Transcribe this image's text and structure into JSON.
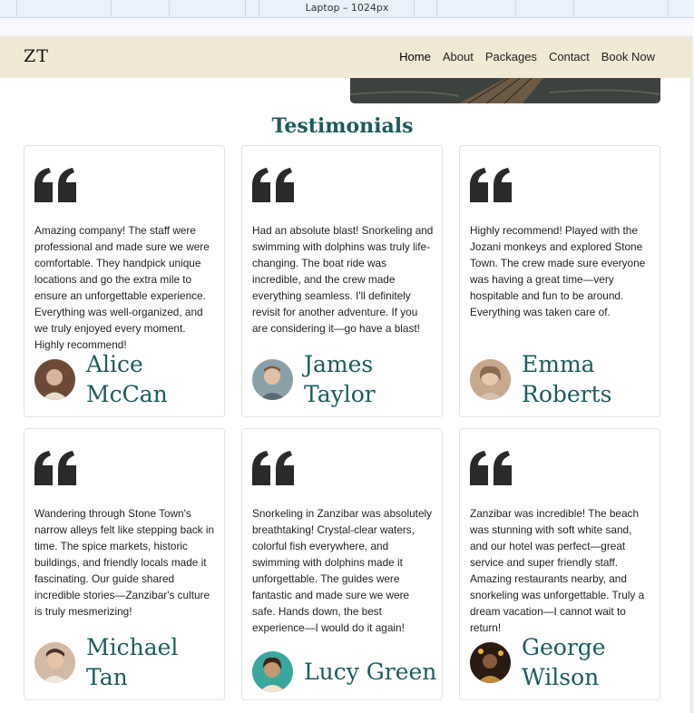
{
  "devtools": {
    "viewport_label": "Laptop – 1024px"
  },
  "nav": {
    "logo": "ZT",
    "links": [
      {
        "label": "Home",
        "active": true
      },
      {
        "label": "About",
        "active": false
      },
      {
        "label": "Packages",
        "active": false
      },
      {
        "label": "Contact",
        "active": false
      },
      {
        "label": "Book Now",
        "active": false
      }
    ]
  },
  "testimonials": {
    "title": "Testimonials",
    "items": [
      {
        "text": "Amazing company! The staff were professional and made sure we were comfortable. They handpick unique locations and go the extra mile to ensure an unforgettable experience. Everything was well-organized, and we truly enjoyed every moment. Highly recommend!",
        "name_line1": "Alice",
        "name_line2": "McCan",
        "avatar_color": "#7a4a34"
      },
      {
        "text": "Had an absolute blast! Snorkeling and swimming with dolphins was truly life-changing. The boat ride was incredible, and the crew made everything seamless. I'll definitely revisit for another adventure. If you are considering it—go have a blast!",
        "name_line1": "James",
        "name_line2": "Taylor",
        "avatar_color": "#8aa0a8"
      },
      {
        "text": "Highly recommend! Played with the Jozani monkeys and explored Stone Town. The crew made sure everyone was having a great time—very hospitable and fun to be around. Everything was taken care of.",
        "name_line1": "Emma",
        "name_line2": "Roberts",
        "avatar_color": "#b08a70"
      },
      {
        "text": "Wandering through Stone Town's narrow alleys felt like stepping back in time. The spice markets, historic buildings, and friendly locals made it fascinating. Our guide shared incredible stories—Zanzibar's culture is truly mesmerizing!",
        "name_line1": "Michael",
        "name_line2": "Tan",
        "avatar_color": "#b89078"
      },
      {
        "text": "Snorkeling in Zanzibar was absolutely breathtaking! Crystal-clear waters, colorful fish everywhere, and swimming with dolphins made it unforgettable. The guides were fantastic and made sure we were safe. Hands down, the best experience—I would do it again!",
        "name_line1": "Lucy Green",
        "name_line2": "",
        "avatar_color": "#3aa6a0"
      },
      {
        "text": "Zanzibar was incredible! The beach was stunning with soft white sand, and our hotel was perfect—great service and super friendly staff. Amazing restaurants nearby, and snorkeling was unforgettable. Truly a dream vacation—I cannot wait to return!",
        "name_line1": "George",
        "name_line2": "Wilson",
        "avatar_color": "#6a3a1a"
      }
    ]
  }
}
